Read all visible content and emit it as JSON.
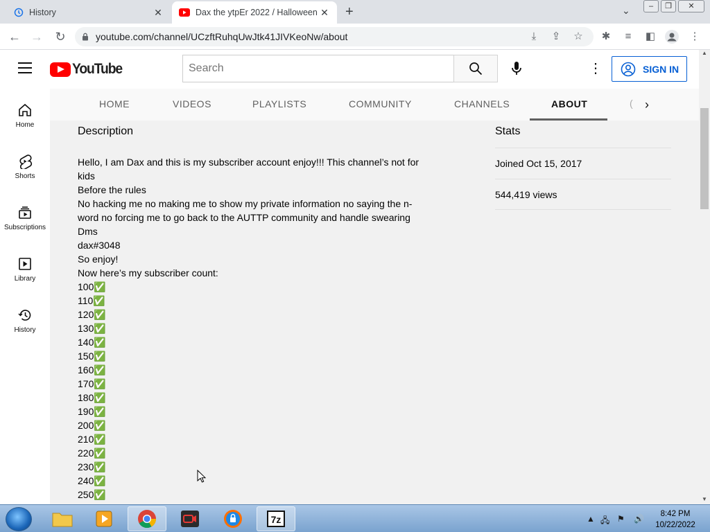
{
  "browser": {
    "tabs": [
      {
        "title": "History",
        "icon": "history-icon",
        "active": false
      },
      {
        "title": "Dax the ytpEr 2022 / Halloween",
        "icon": "youtube-icon",
        "active": true
      }
    ],
    "url": "youtube.com/channel/UCzftRuhqUwJtk41JIVKeoNw/about"
  },
  "youtube": {
    "logo_text": "YouTube",
    "search_placeholder": "Search",
    "sign_in_label": "SIGN IN",
    "left_nav": [
      {
        "label": "Home",
        "icon": "home-icon"
      },
      {
        "label": "Shorts",
        "icon": "shorts-icon"
      },
      {
        "label": "Subscriptions",
        "icon": "subscriptions-icon"
      },
      {
        "label": "Library",
        "icon": "library-icon"
      },
      {
        "label": "History",
        "icon": "history-icon"
      }
    ],
    "channel_tabs": [
      "HOME",
      "VIDEOS",
      "PLAYLISTS",
      "COMMUNITY",
      "CHANNELS",
      "ABOUT"
    ],
    "selected_tab": "ABOUT",
    "about": {
      "description_heading": "Description",
      "description_lines": [
        "Hello, I am Dax and this is my subscriber account enjoy!!! This channel’s not for kids",
        "Before the rules",
        "No hacking me no making me to show my private information no saying the n-word no forcing me to go back to the AUTTP community and handle swearing",
        "Dms",
        "dax#3048",
        "So enjoy!",
        "Now here’s my subscriber count:",
        "100✅",
        "110✅",
        "120✅",
        "130✅",
        "140✅",
        "150✅",
        "160✅",
        "170✅",
        "180✅",
        "190✅",
        "200✅",
        "210✅",
        "220✅",
        "230✅",
        "240✅",
        "250✅"
      ],
      "stats_heading": "Stats",
      "joined": "Joined Oct 15, 2017",
      "views": "544,419 views"
    }
  },
  "taskbar": {
    "time": "8:42 PM",
    "date": "10/22/2022"
  },
  "colors": {
    "youtube_red": "#ff0000",
    "link_blue": "#065fd4",
    "tab_strip": "#dee1e6"
  }
}
